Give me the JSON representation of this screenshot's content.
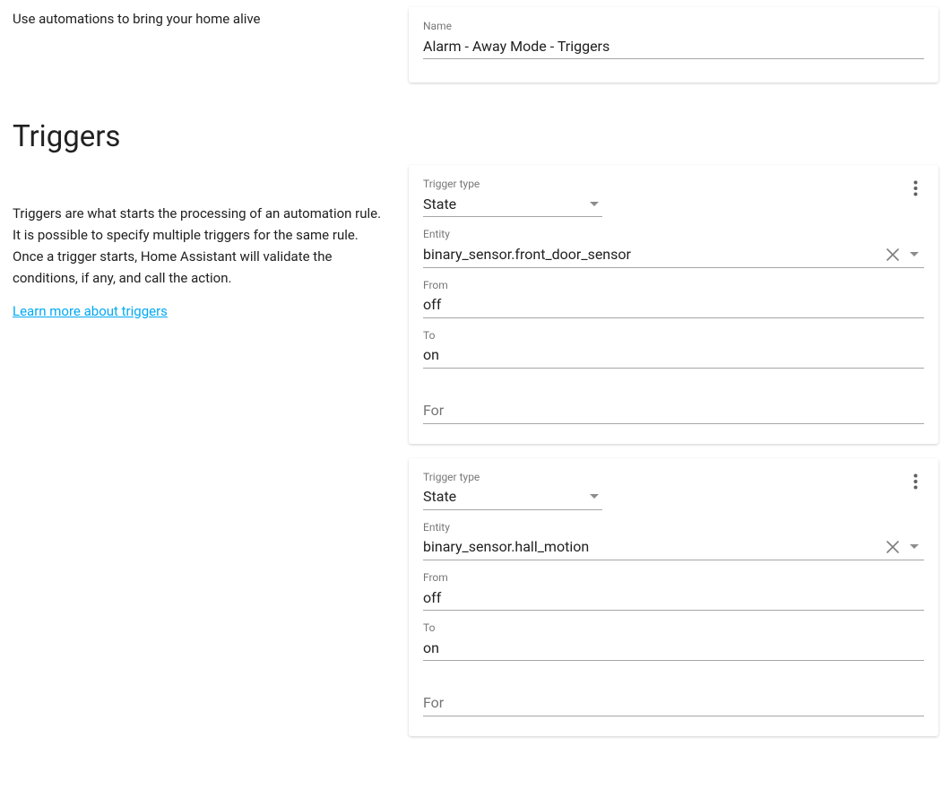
{
  "intro": "Use automations to bring your home alive",
  "name_card": {
    "label": "Name",
    "value": "Alarm - Away Mode - Triggers"
  },
  "triggers_section": {
    "title": "Triggers",
    "description": "Triggers are what starts the processing of an automation rule. It is possible to specify multiple triggers for the same rule. Once a trigger starts, Home Assistant will validate the conditions, if any, and call the action.",
    "learn_more": "Learn more about triggers"
  },
  "labels": {
    "trigger_type": "Trigger type",
    "entity": "Entity",
    "from": "From",
    "to": "To",
    "for": "For"
  },
  "triggers": [
    {
      "type": "State",
      "entity": "binary_sensor.front_door_sensor",
      "from": "off",
      "to": "on",
      "for": ""
    },
    {
      "type": "State",
      "entity": "binary_sensor.hall_motion",
      "from": "off",
      "to": "on",
      "for": ""
    }
  ]
}
